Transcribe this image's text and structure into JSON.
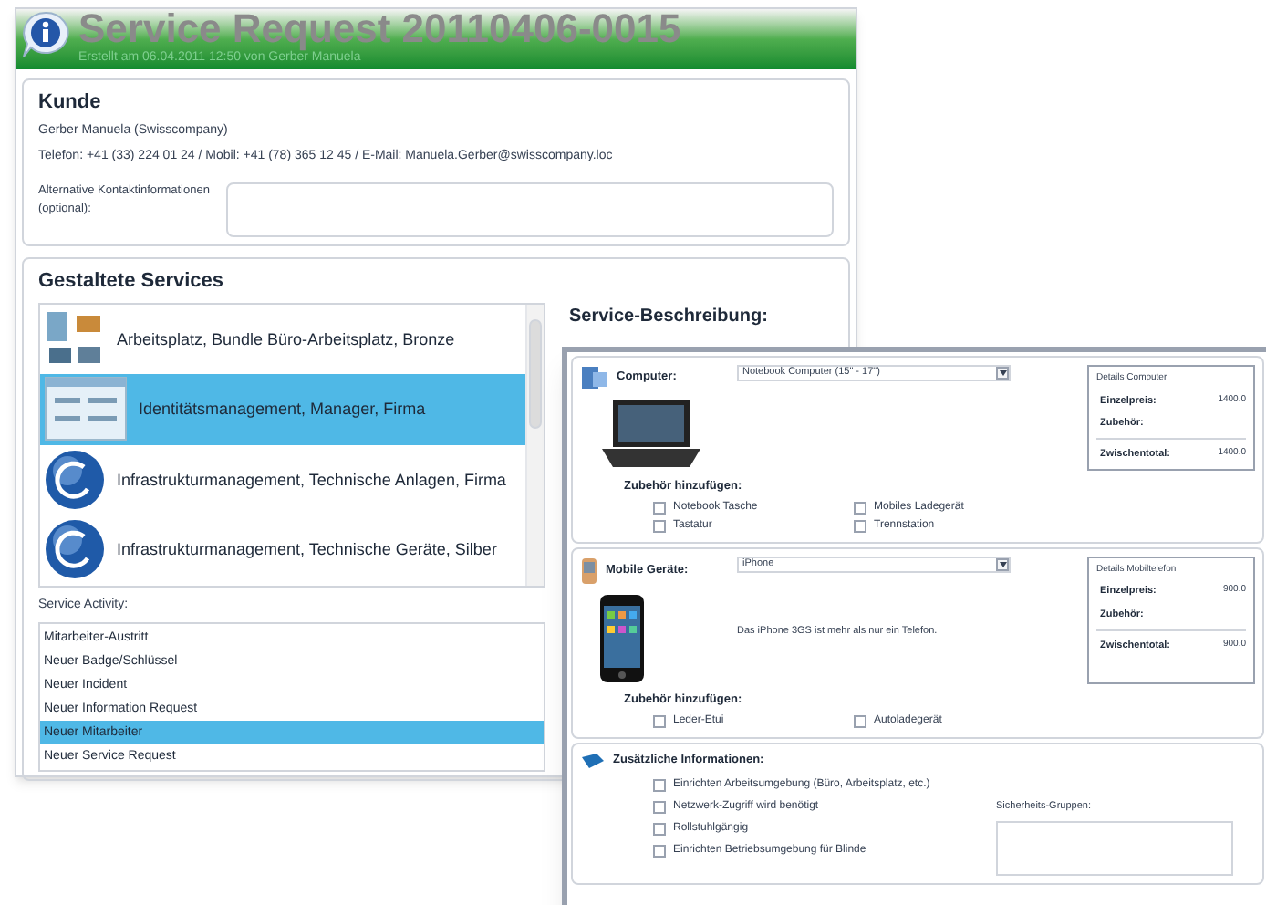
{
  "window": {
    "title": "Service Request 20110406-0015",
    "subtitle": "Erstellt am 06.04.2011 12:50 von Gerber Manuela"
  },
  "customer": {
    "heading": "Kunde",
    "name": "Gerber Manuela (Swisscompany)",
    "contact": "Telefon: +41 (33) 224 01 24 / Mobil: +41 (78) 365 12 45 / E-Mail: Manuela.Gerber@swisscompany.loc",
    "alt_label": "Alternative Kontaktinformationen (optional):"
  },
  "services": {
    "heading": "Gestaltete Services",
    "items": [
      {
        "kind": "workstation",
        "label": "Arbeitsplatz, Bundle Büro-Arbeitsplatz, Bronze",
        "selected": false
      },
      {
        "kind": "identity",
        "label": "Identitätsmanagement, Manager, Firma",
        "selected": true
      },
      {
        "kind": "infrastructure",
        "label": "Infrastrukturmanagement, Technische Anlagen, Firma",
        "selected": false
      },
      {
        "kind": "infrastructure",
        "label": "Infrastrukturmanagement, Technische Geräte, Silber",
        "selected": false
      }
    ],
    "activity_label": "Service Activity:",
    "activities": [
      {
        "label": "Mitarbeiter-Austritt",
        "selected": false
      },
      {
        "label": "Neuer Badge/Schlüssel",
        "selected": false
      },
      {
        "label": "Neuer Incident",
        "selected": false
      },
      {
        "label": "Neuer Information Request",
        "selected": false
      },
      {
        "label": "Neuer Mitarbeiter",
        "selected": true
      },
      {
        "label": "Neuer Service Request",
        "selected": false
      }
    ]
  },
  "description_label": "Service-Beschreibung:",
  "detail_window": {
    "sections": [
      {
        "kind": "computer",
        "label": "Computer:",
        "select_value": "Notebook Computer (15\" - 17\")",
        "details_title": "Details Computer",
        "rows": [
          {
            "label": "Einzelpreis:",
            "value": "1400.0"
          },
          {
            "label": "Zubehör:",
            "value": ""
          },
          {
            "label": "Zwischentotal:",
            "value": "1400.0"
          }
        ],
        "accessories_label": "Zubehör hinzufügen:",
        "accessories": [
          {
            "label": "Notebook Tasche",
            "checked": false
          },
          {
            "label": "Mobiles Ladegerät",
            "checked": false
          },
          {
            "label": "Tastatur",
            "checked": false
          },
          {
            "label": "Trennstation",
            "checked": false
          }
        ]
      },
      {
        "kind": "phone",
        "label": "Mobile Geräte:",
        "select_value": "iPhone",
        "description": "Das iPhone 3GS ist mehr als nur ein Telefon.",
        "details_title": "Details Mobiltelefon",
        "rows": [
          {
            "label": "Einzelpreis:",
            "value": "900.0"
          },
          {
            "label": "Zubehör:",
            "value": ""
          },
          {
            "label": "Zwischentotal:",
            "value": "900.0"
          }
        ],
        "accessories_label": "Zubehör hinzufügen:",
        "accessories": [
          {
            "label": "Leder-Etui",
            "checked": false
          },
          {
            "label": "Autoladegerät",
            "checked": false
          }
        ]
      }
    ],
    "extra": {
      "heading": "Zusätzliche Informationen:",
      "options": [
        {
          "label": "Einrichten Arbeitsumgebung (Büro, Arbeitsplatz, etc.)",
          "checked": false
        },
        {
          "label": "Netzwerk-Zugriff wird benötigt",
          "checked": false
        },
        {
          "label": "Rollstuhlgängig",
          "checked": false
        },
        {
          "label": "Einrichten Betriebsumgebung für Blinde",
          "checked": false
        }
      ],
      "groups_label": "Sicherheits-Gruppen:"
    }
  }
}
